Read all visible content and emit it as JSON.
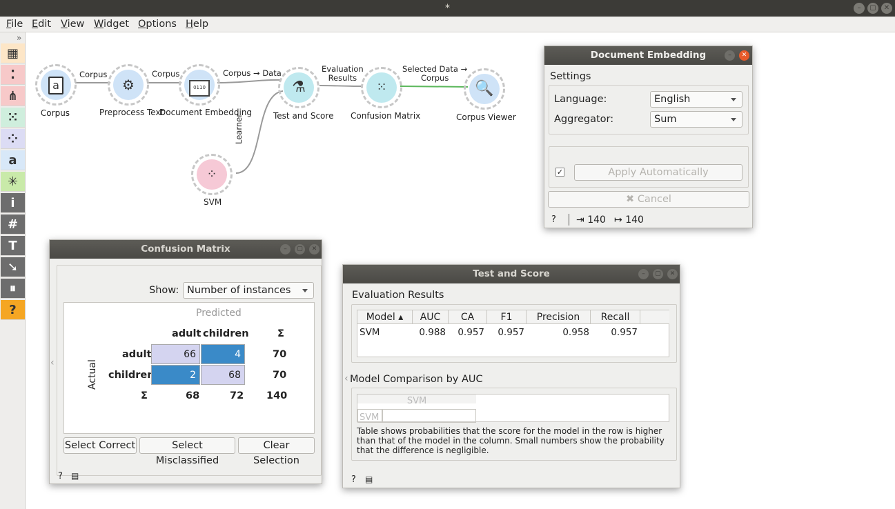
{
  "window": {
    "title": "*"
  },
  "menu": [
    "File",
    "Edit",
    "View",
    "Widget",
    "Options",
    "Help"
  ],
  "toolbox": {
    "expand_glyph": "»",
    "items": [
      {
        "icon": "data-table-icon",
        "glyph": "▦",
        "bg": "#fde6c7"
      },
      {
        "icon": "scatter-plot-icon",
        "glyph": "⁚",
        "bg": "#f7c9c9"
      },
      {
        "icon": "tree-icon",
        "glyph": "⋔",
        "bg": "#f7c9c9"
      },
      {
        "icon": "matrix-icon",
        "glyph": "⁙",
        "bg": "#cfeedd"
      },
      {
        "icon": "cluster-icon",
        "glyph": "⁘",
        "bg": "#dcdcf4"
      },
      {
        "icon": "text-a-icon",
        "glyph": "a",
        "bg": "#d8e8f8"
      },
      {
        "icon": "network-icon",
        "glyph": "✳",
        "bg": "#c9eaa9"
      },
      {
        "icon": "info-icon",
        "glyph": "i",
        "bg": "#6d6d6d"
      },
      {
        "icon": "hash-icon",
        "glyph": "#",
        "bg": "#6d6d6d"
      },
      {
        "icon": "text-icon",
        "glyph": "T",
        "bg": "#6d6d6d"
      },
      {
        "icon": "arrow-icon",
        "glyph": "➘",
        "bg": "#6d6d6d"
      },
      {
        "icon": "pause-icon",
        "glyph": "⏸",
        "bg": "#6d6d6d"
      },
      {
        "icon": "help-icon",
        "glyph": "?",
        "bg": "#f5a623"
      }
    ]
  },
  "workflow": {
    "nodes": {
      "corpus": "Corpus",
      "preprocess": "Preprocess Text",
      "embedding": "Document Embedding",
      "test_score": "Test and Score",
      "confusion": "Confusion Matrix",
      "viewer": "Corpus Viewer",
      "svm": "SVM"
    },
    "links": {
      "corpus_pre": "Corpus",
      "pre_emb": "Corpus",
      "emb_test": "Corpus → Data",
      "test_conf_1": "Evaluation",
      "test_conf_2": "Results",
      "conf_view_1": "Selected Data →",
      "conf_view_2": "Corpus",
      "learner": "Learner"
    }
  },
  "doc_embedding": {
    "title": "Document Embedding",
    "settings_label": "Settings",
    "language_label": "Language:",
    "language_value": "English",
    "aggregator_label": "Aggregator:",
    "aggregator_value": "Sum",
    "checkbox_checked": "✓",
    "apply_label": "Apply Automatically",
    "cancel_label": "Cancel",
    "status_in": "140",
    "status_out": "140"
  },
  "confusion_matrix": {
    "title": "Confusion Matrix",
    "show_label": "Show:",
    "show_value": "Number of instances",
    "predicted_label": "Predicted",
    "actual_label": "Actual",
    "col_headers": [
      "adult",
      "children",
      "Σ"
    ],
    "row_headers": [
      "adult",
      "children",
      "Σ"
    ],
    "cells": [
      [
        "66",
        "4",
        "70"
      ],
      [
        "2",
        "68",
        "70"
      ]
    ],
    "totals": [
      "68",
      "72",
      "140"
    ],
    "buttons": [
      "Select Correct",
      "Select Misclassified",
      "Clear Selection"
    ]
  },
  "test_score": {
    "title": "Test and Score",
    "eval_label": "Evaluation Results",
    "columns": [
      "Model",
      "AUC",
      "CA",
      "F1",
      "Precision",
      "Recall"
    ],
    "row": [
      "SVM",
      "0.988",
      "0.957",
      "0.957",
      "0.958",
      "0.957"
    ],
    "comparison_label": "Model Comparison by AUC",
    "comparison_col": "SVM",
    "comparison_row": "SVM",
    "note": "Table shows probabilities that the score for the model in the row is higher than that of the model in the column. Small numbers show the probability that the difference is negligible."
  },
  "colors": {
    "dark_cell": "#3a8ac8",
    "light_cell": "#d4d4f0",
    "title_bar": "#3c3b37",
    "close_active": "#e85a2a"
  }
}
